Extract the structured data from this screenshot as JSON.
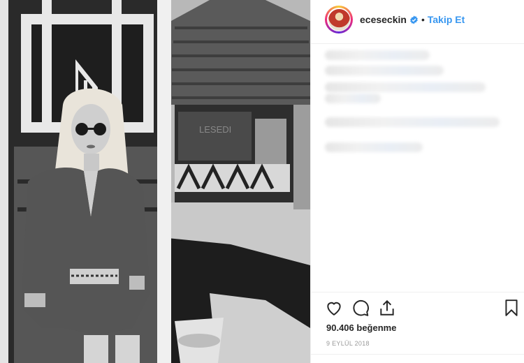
{
  "post": {
    "username": "eceseckin",
    "separator": "•",
    "follow_label": "Takip Et",
    "likes_text": "90.406 beğenme",
    "date_text": "9 EYLÜL 2018"
  },
  "photo": {
    "hut_sign_text": "LESEDI"
  },
  "icons": {
    "verified": "verified-badge-icon",
    "like": "heart-icon",
    "comment": "speech-bubble-icon",
    "share": "share-icon",
    "save": "bookmark-icon"
  },
  "colors": {
    "follow": "#3897f0",
    "verified": "#3897f0",
    "text": "#262626",
    "muted": "#999999"
  }
}
